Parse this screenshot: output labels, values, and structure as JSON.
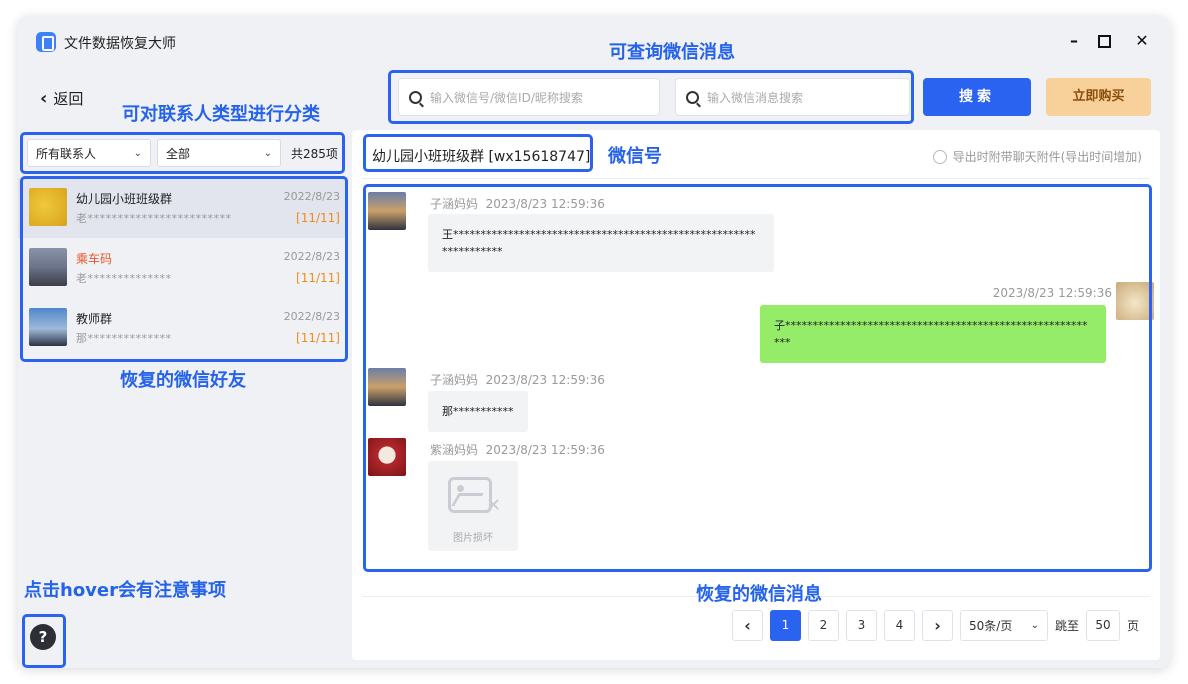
{
  "app": {
    "title": "文件数据恢复大师"
  },
  "nav": {
    "back_label": "返回"
  },
  "annotations": {
    "search": "可查询微信消息",
    "filter": "可对联系人类型进行分类",
    "contacts": "恢复的微信好友",
    "wechat_id": "微信号",
    "messages": "恢复的微信消息",
    "help": "点击hover会有注意事项"
  },
  "filters": {
    "type_value": "所有联系人",
    "scope_value": "全部",
    "count": "共285项"
  },
  "contacts": [
    {
      "name": "幼儿园小班班级群",
      "preview": "老************************",
      "date": "2022/8/23",
      "badge": "[11/11]"
    },
    {
      "name": "乘车码",
      "preview": "老**************",
      "date": "2022/8/23",
      "badge": "[11/11]"
    },
    {
      "name": "教师群",
      "preview": "那**************",
      "date": "2022/8/23",
      "badge": "[11/11]"
    }
  ],
  "search": {
    "wechat_placeholder": "输入微信号/微信ID/昵称搜索",
    "message_placeholder": "输入微信消息搜索",
    "button_label": "搜索",
    "buy_label": "立即购买"
  },
  "chat": {
    "title": "幼儿园小班班级群 [wx15618747]",
    "export_option": "导出时附带聊天附件(导出时间增加)",
    "messages": [
      {
        "sender": "子涵妈妈",
        "time": "2023/8/23 12:59:36",
        "text": "王******************************************************************"
      },
      {
        "sender": "",
        "time": "2023/8/23 12:59:36",
        "text": "子**********************************************************"
      },
      {
        "sender": "子涵妈妈",
        "time": "2023/8/23 12:59:36",
        "text": "那***********"
      },
      {
        "sender": "紫涵妈妈",
        "time": "2023/8/23 12:59:36",
        "image_caption": "图片损坏"
      }
    ]
  },
  "pagination": {
    "pages": [
      "1",
      "2",
      "3",
      "4"
    ],
    "current": "1",
    "prev": "‹",
    "next": "›",
    "page_size": "50条/页",
    "jump_label": "跳至",
    "jump_value": "50",
    "page_unit": "页"
  },
  "icons": {
    "back": "chevron-left-icon",
    "search": "search-icon",
    "help": "question-icon",
    "broken_image": "broken-image-icon"
  },
  "colors": {
    "accent": "#2a63f0",
    "highlight": "#2a63f0",
    "badge": "#f08c1f",
    "contact_red": "#e8562b",
    "my_bubble": "#95ec69",
    "buy": "#f8d19a"
  }
}
